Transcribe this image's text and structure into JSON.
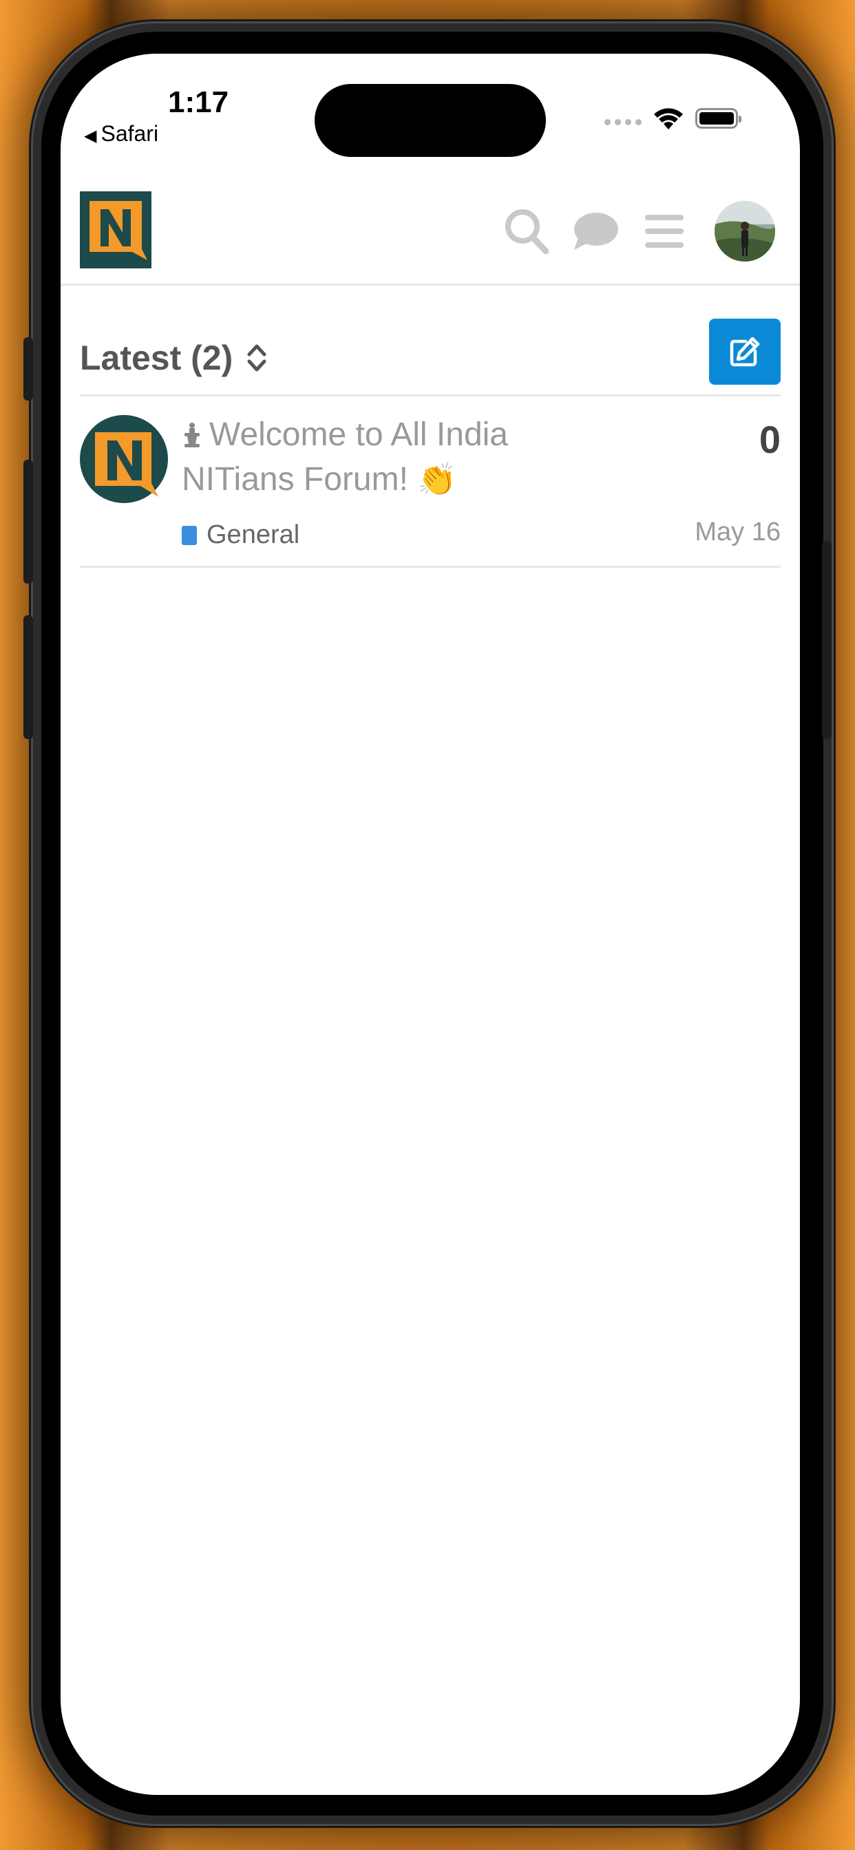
{
  "status_bar": {
    "time": "1:17",
    "back_label": "Safari",
    "back_icon": "back-triangle-icon"
  },
  "header": {
    "logo_letter": "N",
    "icons": [
      "search-icon",
      "chat-bubble-icon",
      "hamburger-menu-icon",
      "user-avatar"
    ]
  },
  "topic_list": {
    "title": "Latest (2)",
    "new_topic_icon": "pencil-edit-icon",
    "topics": [
      {
        "pinned_icon": "pin-icon",
        "title": "Welcome to All India NITians Forum!",
        "emoji": "👏",
        "category": "General",
        "category_color": "#3a8ee0",
        "replies": "0",
        "date": "May 16"
      }
    ]
  },
  "colors": {
    "accent": "#0a8ad6",
    "logo_bg": "#1d4a4a",
    "logo_fg": "#f39a2b"
  }
}
